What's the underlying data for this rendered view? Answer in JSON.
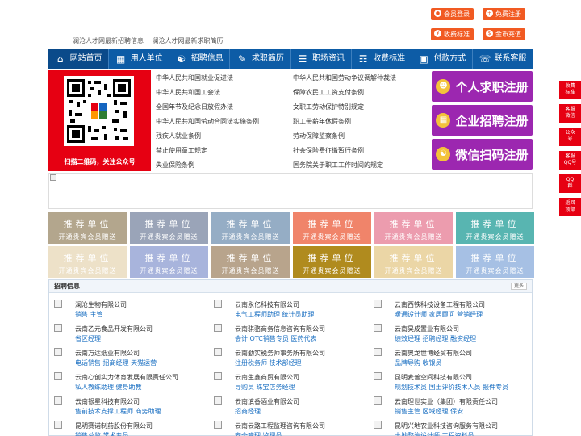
{
  "top_links": [
    "澜沧人才网最新招聘信息",
    "澜沧人才网最新求职简历"
  ],
  "top_buttons": [
    {
      "label": "会员登录",
      "icon": "user-icon"
    },
    {
      "label": "免费注册",
      "icon": "register-icon"
    },
    {
      "label": "收费标准",
      "icon": "price-icon"
    },
    {
      "label": "金币充值",
      "icon": "coin-icon"
    }
  ],
  "nav": [
    {
      "label": "网站首页",
      "icon": "home-icon"
    },
    {
      "label": "用人单位",
      "icon": "building-icon"
    },
    {
      "label": "招聘信息",
      "icon": "recruit-icon"
    },
    {
      "label": "求职简历",
      "icon": "resume-icon"
    },
    {
      "label": "职场资讯",
      "icon": "news-icon"
    },
    {
      "label": "收费标准",
      "icon": "price-icon"
    },
    {
      "label": "付款方式",
      "icon": "payment-icon"
    },
    {
      "label": "联系客服",
      "icon": "phone-icon"
    }
  ],
  "qr_caption": "扫描二维码，关注公众号",
  "laws_left": [
    "中华人民共和国就业促进法",
    "中华人民共和国工会法",
    "全国年节及纪念日放假办法",
    "中华人民共和国劳动合同法实施条例",
    "残疾人就业条例",
    "禁止使用童工规定",
    "失业保险条例"
  ],
  "laws_right": [
    "中华人民共和国劳动争议调解仲裁法",
    "保障农民工工资支付条例",
    "女职工劳动保护特别规定",
    "职工带薪年休假条例",
    "劳动保障监察条例",
    "社会保险费征缴暂行条例",
    "国务院关于职工工作时间的规定"
  ],
  "register_buttons": [
    {
      "label": "个人求职注册",
      "icon": "person-icon"
    },
    {
      "label": "企业招聘注册",
      "icon": "company-icon"
    },
    {
      "label": "微信扫码注册",
      "icon": "wechat-icon"
    }
  ],
  "recommend": {
    "title": "推荐单位",
    "subtitle": "开通贵宾会员赠送"
  },
  "recommend_colors": [
    "#b3a68d",
    "#9aa4b8",
    "#95adc5",
    "#f0846a",
    "#ec9cae",
    "#58b5b1",
    "#ede1c8",
    "#a8b4dc",
    "#b8a48c",
    "#b08b1e",
    "#ebd6a6",
    "#a6c0e4"
  ],
  "jobs_section": {
    "title": "招聘信息",
    "more": "更多"
  },
  "jobs": [
    {
      "company": "澜沧生物有限公司",
      "positions": "销售 主管"
    },
    {
      "company": "云南永亿科技有限公司",
      "positions": "电气工程师助理 统计员助理"
    },
    {
      "company": "云南西铁科技设备工程有限公司",
      "positions": "暖通设计师 家居顾问 营销经理"
    },
    {
      "company": "云南乙元食品开发有限公司",
      "positions": "省区经理"
    },
    {
      "company": "云南骐骆商务信息咨询有限公司",
      "positions": "会计 OTC销售专员 医药代表"
    },
    {
      "company": "云南昊成置业有限公司",
      "positions": "绩效经理 招聘经理 融资经理"
    },
    {
      "company": "云南万达纸业有限公司",
      "positions": "电话销售 招商经理 天猫运营"
    },
    {
      "company": "云南勤实税务师事务所有限公司",
      "positions": "注册税务师 技术部经理"
    },
    {
      "company": "云南奥龙世博经贸有限公司",
      "positions": "品牌导购 收银员"
    },
    {
      "company": "云南心创实力体育发展有限责任公司",
      "positions": "私人教练助理 健身助教"
    },
    {
      "company": "云南生鑫商贸有限公司",
      "positions": "导购员 珠宝店务经理"
    },
    {
      "company": "昆明麦普空间科技有限公司",
      "positions": "规划技术员 国土评价技术人员 报件专员"
    },
    {
      "company": "云南银星科技有限公司",
      "positions": "售前技术支撑工程师 商务助理"
    },
    {
      "company": "云南滇香酒业有限公司",
      "positions": "招商经理"
    },
    {
      "company": "云南理世实业（集团）有限责任公司",
      "positions": "销售主管 区域经理 保安"
    },
    {
      "company": "昆明赛诺制药股份有限公司",
      "positions": "销售总监 学术专员"
    },
    {
      "company": "云南云路工程监理咨询有限公司",
      "positions": "安全管理 监理员"
    },
    {
      "company": "昆明兴地农业科技咨询服务有限公司",
      "positions": "土地整治设计师 工程资料员"
    }
  ],
  "sidebar": [
    {
      "label": "收费\n标准",
      "icon": "price-icon"
    },
    {
      "label": "客服\n微信",
      "icon": "wechat-icon"
    },
    {
      "label": "公众\n号",
      "icon": "wechat-official-icon"
    },
    {
      "label": "客服\nQQ号",
      "icon": "qq-icon"
    },
    {
      "label": "QQ\n群",
      "icon": "qq-group-icon"
    },
    {
      "label": "返回\n顶部",
      "icon": "arrow-up-icon"
    }
  ]
}
